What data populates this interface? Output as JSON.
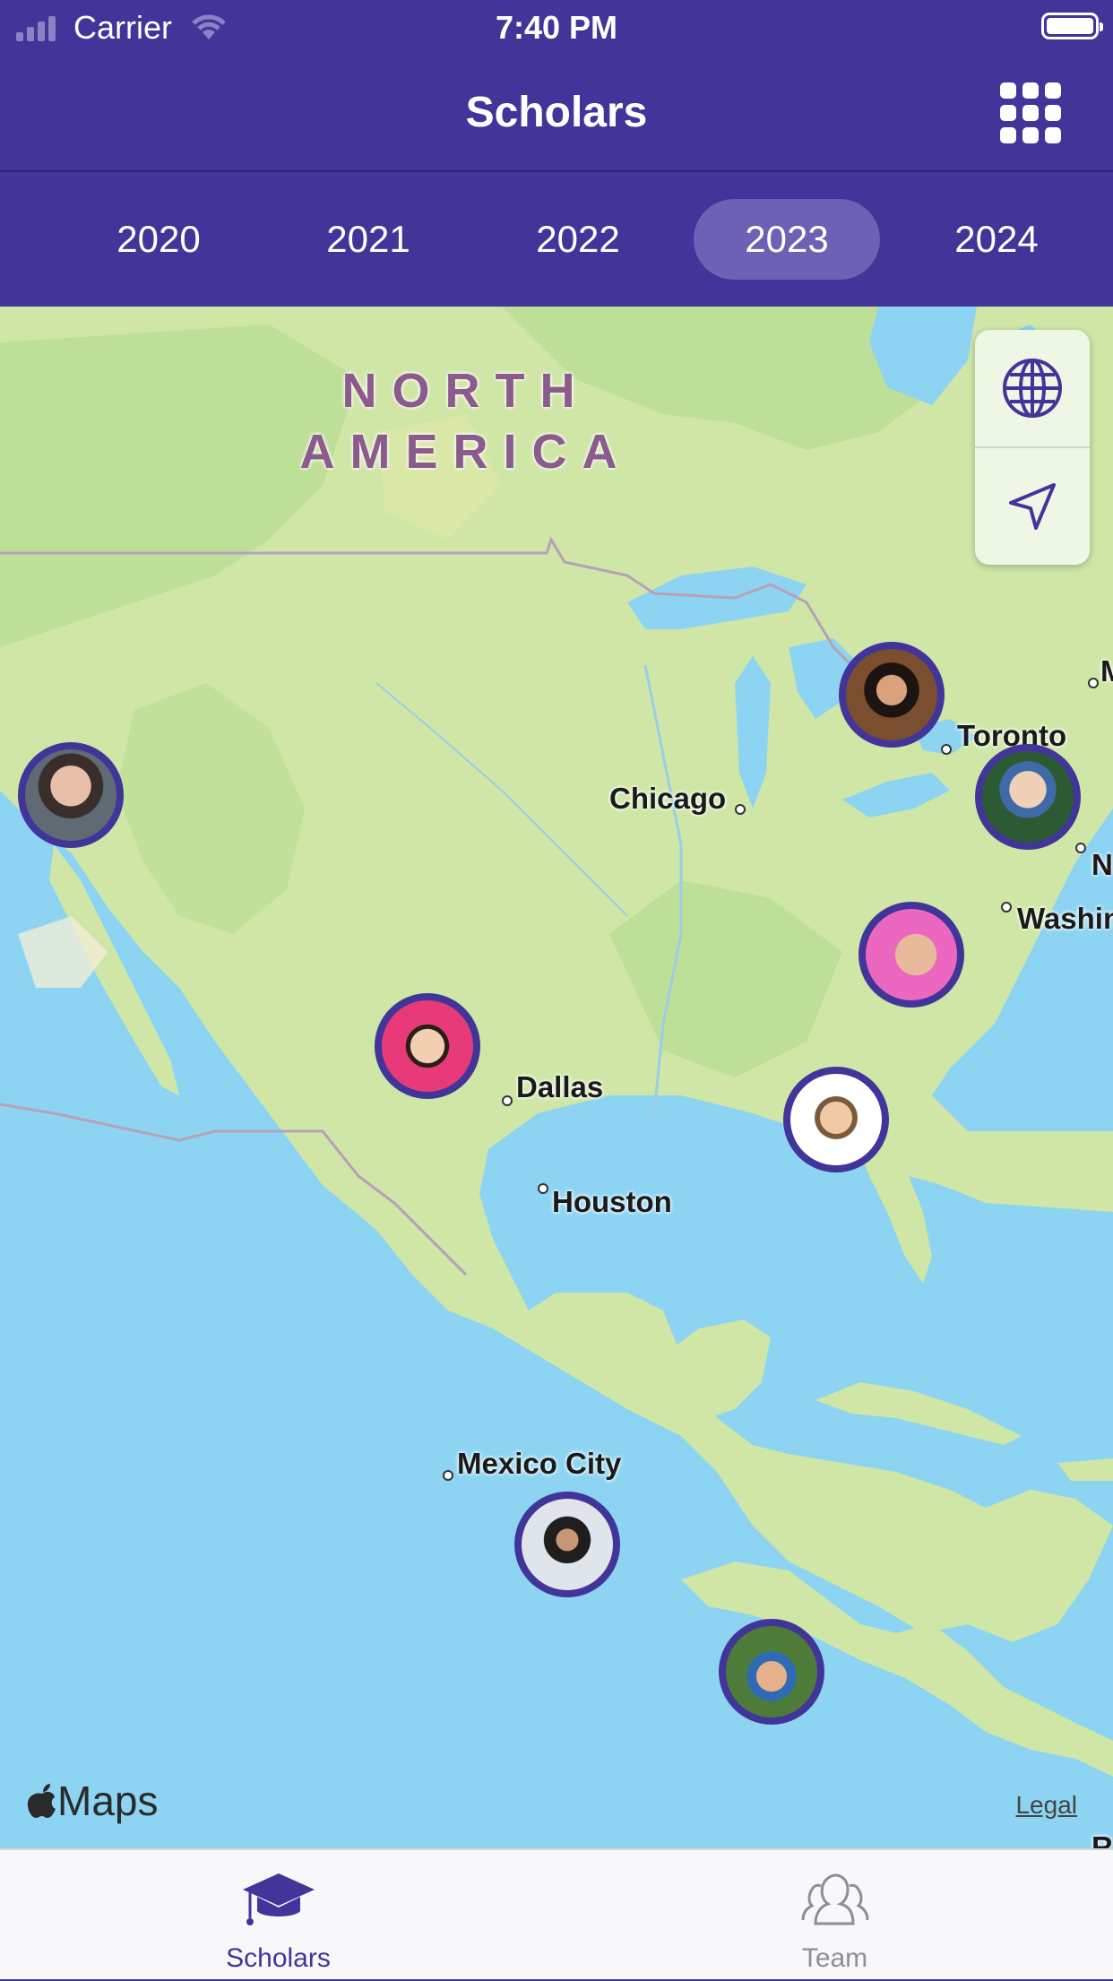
{
  "status_bar": {
    "carrier": "Carrier",
    "time": "7:40 PM"
  },
  "nav": {
    "title": "Scholars",
    "grid_icon": "grid-icon"
  },
  "years": {
    "items": [
      "2020",
      "2021",
      "2022",
      "2023",
      "2024"
    ],
    "selected": "2023"
  },
  "map": {
    "continent_line1": "NORTH",
    "continent_line2": "AMERICA",
    "cities": {
      "toronto": "Toronto",
      "chicago": "Chicago",
      "washington": "Washin",
      "dallas": "Dallas",
      "houston": "Houston",
      "mexico_city": "Mexico City",
      "edge_m": "M",
      "edge_n": "N",
      "edge_r": "R"
    },
    "maps_label": "Maps",
    "legal": "Legal",
    "controls": [
      "globe-icon",
      "location-arrow-icon"
    ],
    "colors": {
      "water": "#8dd4f3",
      "land": "#cfe6a6",
      "pin_ring": "#41359a"
    }
  },
  "tabs": {
    "scholars": {
      "label": "Scholars",
      "active": true,
      "color": "#41359a"
    },
    "team": {
      "label": "Team",
      "active": false,
      "color": "#8e8e93"
    }
  }
}
